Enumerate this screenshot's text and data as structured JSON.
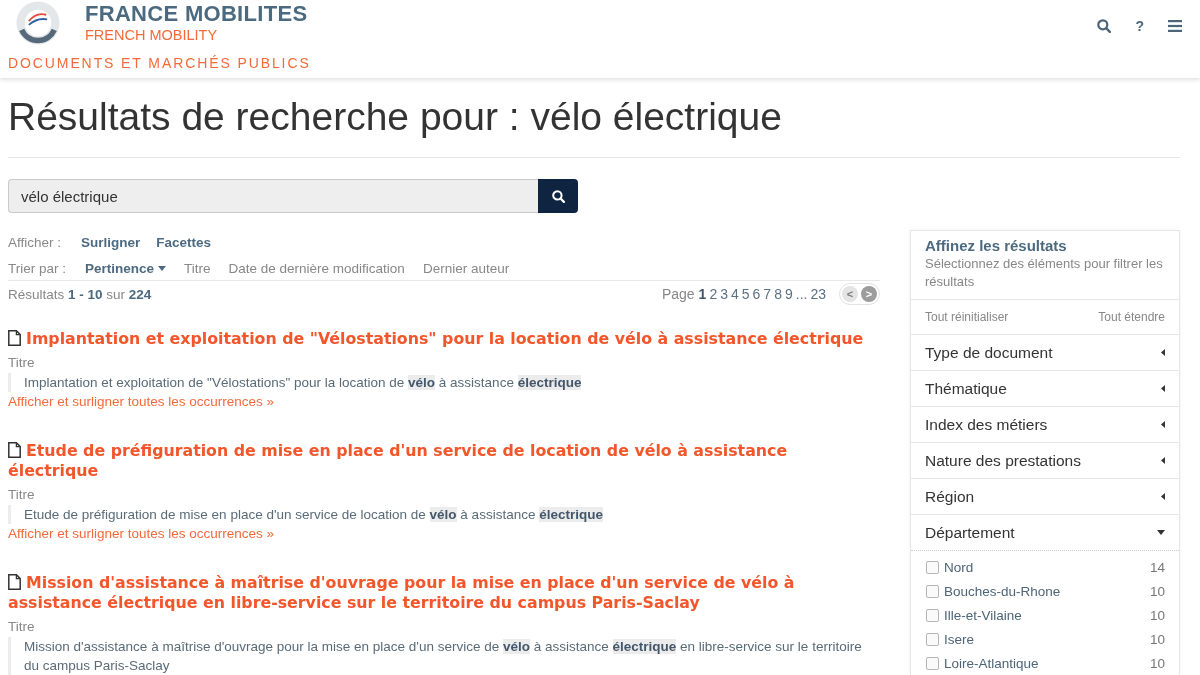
{
  "header": {
    "site_title": "FRANCE MOBILITES",
    "site_subtitle": "FRENCH MOBILITY",
    "section_title": "DOCUMENTS ET MARCHÉS PUBLICS",
    "nav_buttons": [
      {
        "kind": "search"
      },
      {
        "kind": "help",
        "label": "?"
      },
      {
        "kind": "menu"
      }
    ]
  },
  "page_title": "Résultats de recherche pour : vélo électrique",
  "search": {
    "value": "vélo électrique"
  },
  "display": {
    "label": "Afficher :",
    "options": [
      "Surligner",
      "Facettes"
    ]
  },
  "sort": {
    "label": "Trier par :",
    "options": [
      {
        "label": "Pertinence",
        "selected": true
      },
      {
        "label": "Titre",
        "selected": false
      },
      {
        "label": "Date de dernière modification",
        "selected": false
      },
      {
        "label": "Dernier auteur",
        "selected": false
      }
    ]
  },
  "results_summary": "Résultats **1 - 10** sur **224**",
  "pagination": {
    "label": "Page",
    "pages": [
      {
        "label": "1",
        "selected": true
      },
      {
        "label": "2",
        "selected": false
      },
      {
        "label": "3",
        "selected": false
      },
      {
        "label": "4",
        "selected": false
      },
      {
        "label": "5",
        "selected": false
      },
      {
        "label": "6",
        "selected": false
      },
      {
        "label": "7",
        "selected": false
      },
      {
        "label": "8",
        "selected": false
      },
      {
        "label": "9",
        "selected": false
      }
    ],
    "gap": "...",
    "last_page": "23",
    "prev": {
      "label": "<",
      "disabled": true
    },
    "next": {
      "label": ">",
      "disabled": false
    }
  },
  "results": [
    {
      "title": "Implantation et exploitation de \"Vélostations\" pour la location de vélo à assistance électrique",
      "field_label": "Titre",
      "excerpt": "Implantation et exploitation de \"Vélostations\" pour la location de **vélo** à assistance **électrique**",
      "more_link": "Afficher et surligner toutes les occurrences »"
    },
    {
      "title": "Etude de préfiguration de mise en place d'un service de location de vélo à assistance électrique",
      "field_label": "Titre",
      "excerpt": "Etude de préfiguration de mise en place d'un service de location de **vélo** à assistance **électrique**",
      "more_link": "Afficher et surligner toutes les occurrences »"
    },
    {
      "title": "Mission d'assistance à maîtrise d'ouvrage pour la mise en place d'un service de vélo à assistance électrique en libre-service sur le territoire du campus Paris-Saclay",
      "field_label": "Titre",
      "excerpt": "Mission d'assistance à maîtrise d'ouvrage pour la mise en place d'un service de **vélo** à assistance **électrique** en libre-service sur le territoire du campus Paris-Saclay"
    }
  ],
  "sidebar": {
    "title": "Affinez les résultats",
    "subtitle": "Sélectionnez des éléments pour filtrer les résultats",
    "reset_all": "Tout réinitialiser",
    "expand_all": "Tout étendre",
    "facets": [
      {
        "label": "Type de document",
        "expanded": false
      },
      {
        "label": "Thématique",
        "expanded": false
      },
      {
        "label": "Index des métiers",
        "expanded": false
      },
      {
        "label": "Nature des prestations",
        "expanded": false
      },
      {
        "label": "Région",
        "expanded": false
      },
      {
        "label": "Département",
        "expanded": true,
        "options": [
          {
            "label": "Nord",
            "count": "14",
            "checked": false
          },
          {
            "label": "Bouches-du-Rhone",
            "count": "10",
            "checked": false
          },
          {
            "label": "Ille-et-Vilaine",
            "count": "10",
            "checked": false
          },
          {
            "label": "Isere",
            "count": "10",
            "checked": false
          },
          {
            "label": "Loire-Atlantique",
            "count": "10",
            "checked": false
          }
        ]
      }
    ]
  }
}
